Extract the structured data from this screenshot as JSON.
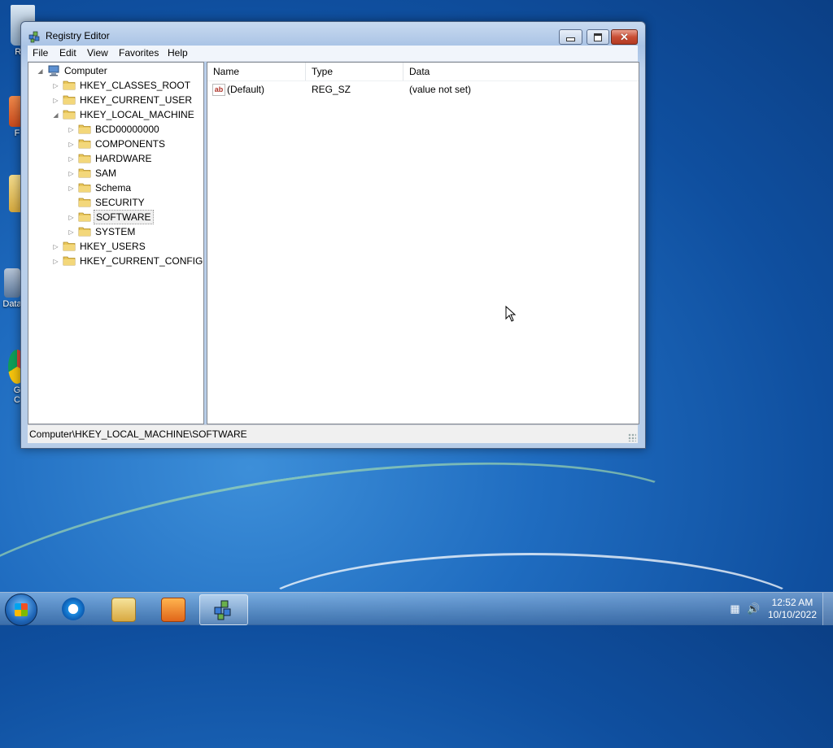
{
  "colors": {
    "desktop": "#1f6cc0",
    "window_frame": "#b7cde8",
    "close_button": "#c94e35"
  },
  "desktop": {
    "icons": [
      {
        "label": "Rec",
        "icon": "recycle-bin-icon"
      },
      {
        "label": "F",
        "icon": "shortcut-icon"
      },
      {
        "label": "",
        "icon": "folder-icon"
      },
      {
        "label": "Data",
        "icon": "shortcut-icon"
      },
      {
        "label": "G\nC",
        "icon": "shortcut-icon"
      }
    ]
  },
  "window": {
    "title": "Registry Editor",
    "icon": "regedit-icon",
    "controls": {
      "minimize": "minimize-icon",
      "maximize": "maximize-icon",
      "close": "close-icon"
    }
  },
  "menu": {
    "file": "File",
    "edit": "Edit",
    "view": "View",
    "favorites": "Favorites",
    "help": "Help"
  },
  "tree": {
    "root": "Computer",
    "hives": [
      {
        "label": "HKEY_CLASSES_ROOT",
        "expanded": false
      },
      {
        "label": "HKEY_CURRENT_USER",
        "expanded": false
      },
      {
        "label": "HKEY_LOCAL_MACHINE",
        "expanded": true
      },
      {
        "label": "HKEY_USERS",
        "expanded": false
      },
      {
        "label": "HKEY_CURRENT_CONFIG",
        "expanded": false
      }
    ],
    "hklm_children": [
      {
        "label": "BCD00000000",
        "has_children": true
      },
      {
        "label": "COMPONENTS",
        "has_children": true
      },
      {
        "label": "HARDWARE",
        "has_children": true
      },
      {
        "label": "SAM",
        "has_children": true
      },
      {
        "label": "Schema",
        "has_children": true
      },
      {
        "label": "SECURITY",
        "has_children": false
      },
      {
        "label": "SOFTWARE",
        "has_children": true,
        "selected": true
      },
      {
        "label": "SYSTEM",
        "has_children": true
      }
    ]
  },
  "list": {
    "columns": [
      "Name",
      "Type",
      "Data"
    ],
    "rows": [
      {
        "icon": "string-value-icon",
        "icon_text": "ab",
        "name": "(Default)",
        "type": "REG_SZ",
        "data": "(value not set)"
      }
    ]
  },
  "status": {
    "path": "Computer\\HKEY_LOCAL_MACHINE\\SOFTWARE"
  },
  "taskbar": {
    "start": "start-button-icon",
    "pinned": [
      "internet-explorer-icon",
      "file-explorer-icon",
      "media-player-icon",
      "regedit-icon"
    ],
    "active_index": 3,
    "time": "12:52 AM",
    "date": "10/10/2022"
  }
}
